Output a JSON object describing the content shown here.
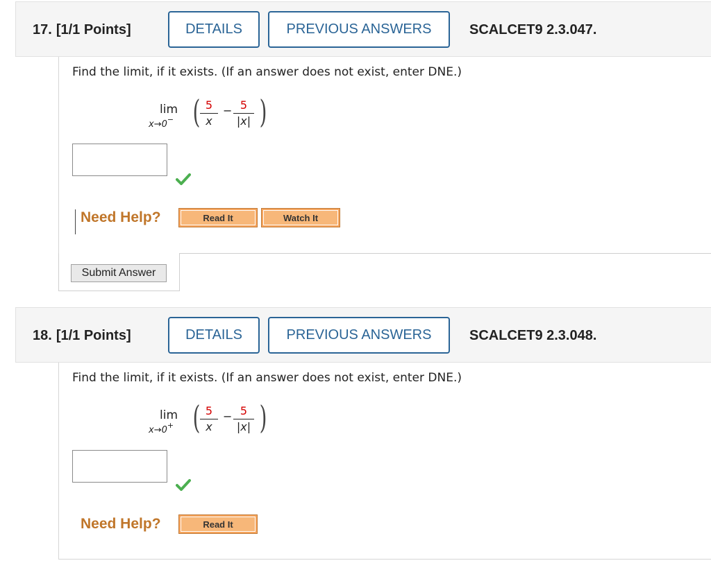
{
  "questions": [
    {
      "number": "17.",
      "points": "[1/1 Points]",
      "details_label": "DETAILS",
      "previous_label": "PREVIOUS ANSWERS",
      "source": "SCALCET9 2.3.047.",
      "prompt": "Find the limit, if it exists. (If an answer does not exist, enter DNE.)",
      "limit_word": "lim",
      "limit_var": "x→0",
      "limit_side": "−",
      "frac1_num": "5",
      "frac1_den": "x",
      "frac2_num": "5",
      "frac2_den": "|x|",
      "answer_value": "",
      "answer_status": "correct",
      "need_help": "Need Help?",
      "help_buttons": [
        "Read It",
        "Watch It"
      ]
    },
    {
      "number": "18.",
      "points": "[1/1 Points]",
      "details_label": "DETAILS",
      "previous_label": "PREVIOUS ANSWERS",
      "source": "SCALCET9 2.3.048.",
      "prompt": "Find the limit, if it exists. (If an answer does not exist, enter DNE.)",
      "limit_word": "lim",
      "limit_var": "x→0",
      "limit_side": "+",
      "frac1_num": "5",
      "frac1_den": "x",
      "frac2_num": "5",
      "frac2_den": "|x|",
      "answer_value": "",
      "answer_status": "correct",
      "need_help": "Need Help?",
      "help_buttons": [
        "Read It"
      ]
    }
  ],
  "submit_label": "Submit Answer",
  "colors": {
    "accent": "#2a6496",
    "help_text": "#c0762a",
    "help_button": "#f6a45c",
    "fraction_numerator": "#d40000",
    "check": "#4caf50"
  }
}
